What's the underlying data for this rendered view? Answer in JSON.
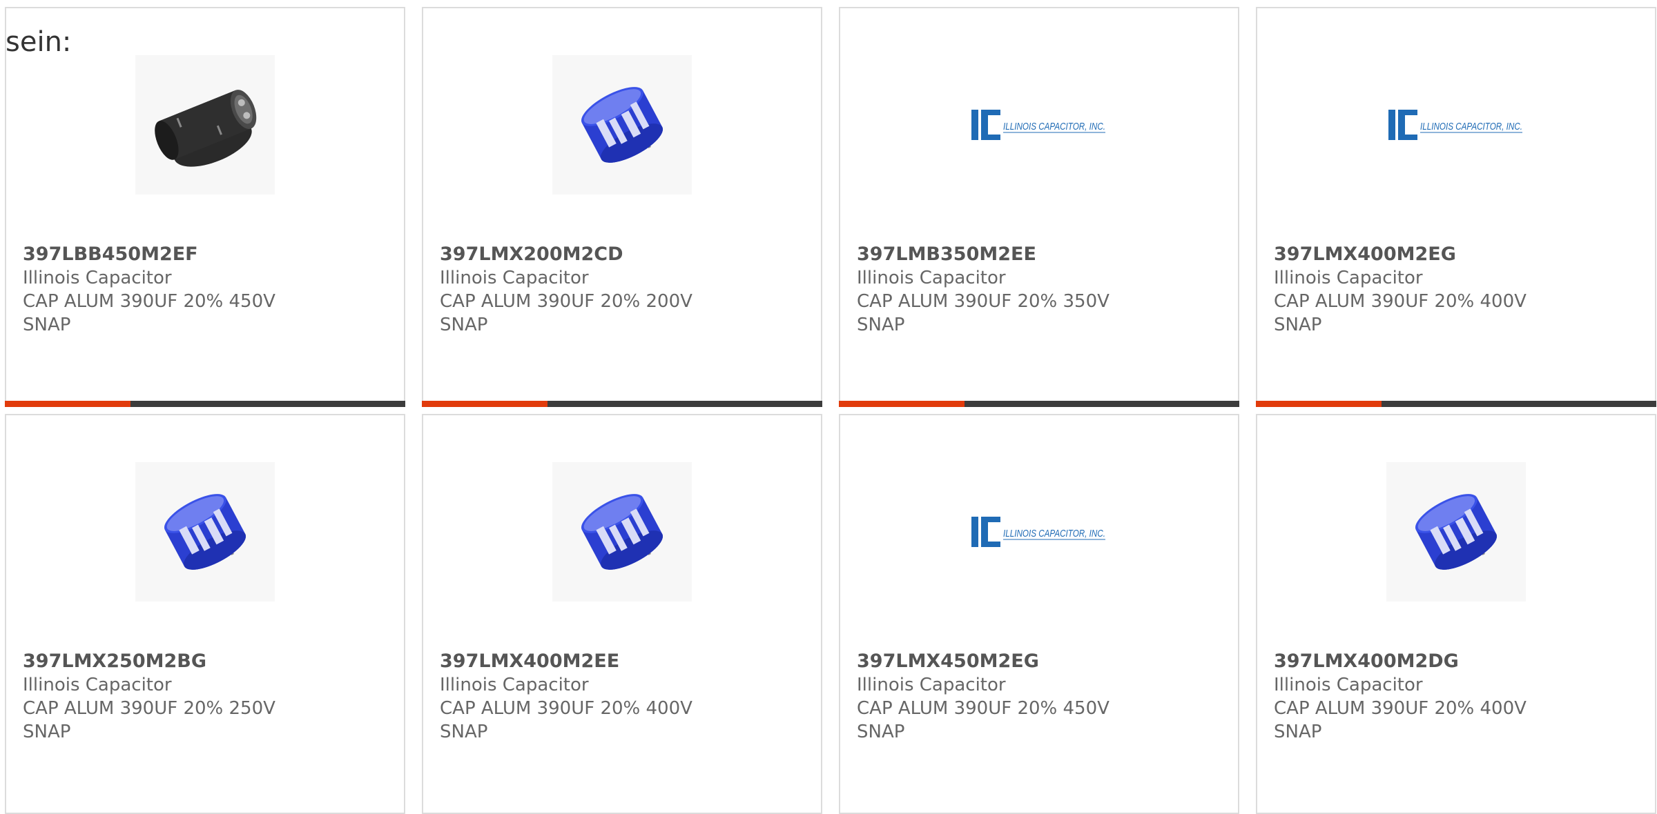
{
  "intro_text": "sein:",
  "products": [
    {
      "part_number": "397LBB450M2EF",
      "manufacturer": "Illinois Capacitor",
      "description": "CAP ALUM 390UF 20% 450V",
      "package": "SNAP",
      "image": "black-capacitor"
    },
    {
      "part_number": "397LMX200M2CD",
      "manufacturer": "Illinois Capacitor",
      "description": "CAP ALUM 390UF 20% 200V",
      "package": "SNAP",
      "image": "blue-capacitor"
    },
    {
      "part_number": "397LMB350M2EE",
      "manufacturer": "Illinois Capacitor",
      "description": "CAP ALUM 390UF 20% 350V",
      "package": "SNAP",
      "image": "ic-logo"
    },
    {
      "part_number": "397LMX400M2EG",
      "manufacturer": "Illinois Capacitor",
      "description": "CAP ALUM 390UF 20% 400V",
      "package": "SNAP",
      "image": "ic-logo"
    },
    {
      "part_number": "397LMX250M2BG",
      "manufacturer": "Illinois Capacitor",
      "description": "CAP ALUM 390UF 20% 250V",
      "package": "SNAP",
      "image": "blue-capacitor"
    },
    {
      "part_number": "397LMX400M2EE",
      "manufacturer": "Illinois Capacitor",
      "description": "CAP ALUM 390UF 20% 400V",
      "package": "SNAP",
      "image": "blue-capacitor"
    },
    {
      "part_number": "397LMX450M2EG",
      "manufacturer": "Illinois Capacitor",
      "description": "CAP ALUM 390UF 20% 450V",
      "package": "SNAP",
      "image": "ic-logo"
    },
    {
      "part_number": "397LMX400M2DG",
      "manufacturer": "Illinois Capacitor",
      "description": "CAP ALUM 390UF 20% 400V",
      "package": "SNAP",
      "image": "blue-capacitor"
    }
  ],
  "logo_text": "ILLINOIS CAPACITOR, INC.",
  "logo_mark": "IC",
  "colors": {
    "accent": "#e13b0c",
    "bar": "#3c3c3c",
    "capacitor_blue": "#2b3fd1",
    "logo_blue": "#1f6bb5"
  }
}
